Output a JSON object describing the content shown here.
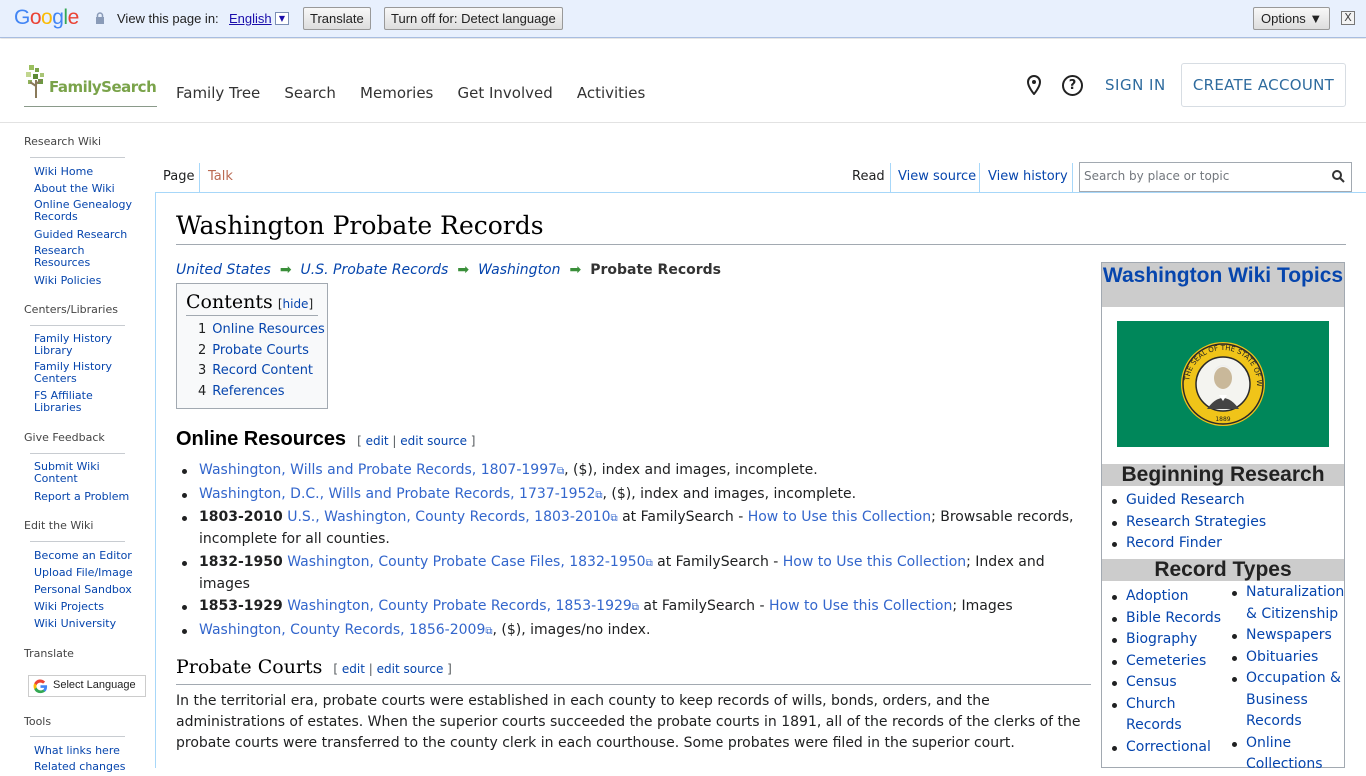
{
  "translate_bar": {
    "brand": "Google",
    "view_text": "View this page in:",
    "language": "English",
    "translate_btn": "Translate",
    "turn_off_btn": "Turn off for: Detect language",
    "options_btn": "Options ▼",
    "close": "X"
  },
  "header": {
    "logo_text": "FamilySearch",
    "nav": [
      "Family Tree",
      "Search",
      "Memories",
      "Get Involved",
      "Activities"
    ],
    "sign_in": "SIGN IN",
    "create_account": "CREATE ACCOUNT"
  },
  "sidebar": {
    "sections": [
      {
        "title": "Research Wiki",
        "items": [
          "Wiki Home",
          "About the Wiki",
          "Online Genealogy Records",
          "Guided Research",
          "Research Resources",
          "Wiki Policies"
        ]
      },
      {
        "title": "Centers/Libraries",
        "items": [
          "Family History Library",
          "Family History Centers",
          "FS Affiliate Libraries"
        ]
      },
      {
        "title": "Give Feedback",
        "items": [
          "Submit Wiki Content",
          "Report a Problem"
        ]
      },
      {
        "title": "Edit the Wiki",
        "items": [
          "Become an Editor",
          "Upload File/Image",
          "Personal Sandbox",
          "Wiki Projects",
          "Wiki University"
        ]
      },
      {
        "title": "Translate",
        "items": []
      },
      {
        "title": "Tools",
        "items": [
          "What links here",
          "Related changes"
        ]
      }
    ],
    "select_language": "Select Language"
  },
  "tabs": {
    "page": "Page",
    "talk": "Talk",
    "read": "Read",
    "view_source": "View source",
    "view_history": "View history",
    "search_placeholder": "Search by place or topic"
  },
  "article": {
    "title": "Washington Probate Records",
    "breadcrumb": [
      "United States",
      "U.S. Probate Records",
      "Washington"
    ],
    "breadcrumb_current": "Probate Records",
    "toc": {
      "title": "Contents",
      "hide": "hide",
      "items": [
        {
          "num": "1",
          "label": "Online Resources"
        },
        {
          "num": "2",
          "label": "Probate Courts"
        },
        {
          "num": "3",
          "label": "Record Content"
        },
        {
          "num": "4",
          "label": "References"
        }
      ]
    },
    "online_resources": {
      "heading": "Online Resources",
      "edit": "edit",
      "edit_source": "edit source",
      "items": [
        {
          "prefix": "",
          "link": "Washington, Wills and Probate Records, 1807-1997",
          "mid": ", ($), index and images, incomplete.",
          "how": "",
          "suffix": ""
        },
        {
          "prefix": "",
          "link": "Washington, D.C., Wills and Probate Records, 1737-1952",
          "mid": ", ($), index and images, incomplete.",
          "how": "",
          "suffix": ""
        },
        {
          "prefix": "1803-2010",
          "link": "U.S., Washington, County Records, 1803-2010",
          "mid": " at FamilySearch - ",
          "how": "How to Use this Collection",
          "suffix": "; Browsable records, incomplete for all counties."
        },
        {
          "prefix": "1832-1950",
          "link": "Washington, County Probate Case Files, 1832-1950",
          "mid": " at FamilySearch - ",
          "how": "How to Use this Collection",
          "suffix": "; Index and images"
        },
        {
          "prefix": "1853-1929",
          "link": "Washington, County Probate Records, 1853-1929",
          "mid": " at FamilySearch - ",
          "how": "How to Use this Collection",
          "suffix": "; Images"
        },
        {
          "prefix": "",
          "link": "Washington, County Records, 1856-2009",
          "mid": ", ($), images/no index.",
          "how": "",
          "suffix": ""
        }
      ]
    },
    "probate_courts": {
      "heading": "Probate Courts",
      "edit": "edit",
      "edit_source": "edit source",
      "paragraph": "In the territorial era, probate courts were established in each county to keep records of wills, bonds, orders, and the administrations of estates. When the superior courts succeeded the probate courts in 1891, all of the records of the clerks of the probate courts were transferred to the county clerk in each courthouse. Some probates were filed in the superior court."
    }
  },
  "infobox": {
    "title": "Washington Wiki Topics",
    "seal_text": "THE SEAL OF THE STATE OF WASHINGTON",
    "seal_year": "1889",
    "beginning_research": "Beginning Research",
    "beginning_items": [
      "Guided Research",
      "Research Strategies",
      "Record Finder"
    ],
    "record_types": "Record Types",
    "record_left": [
      "Adoption",
      "Bible Records",
      "Biography",
      "Cemeteries",
      "Census",
      "Church Records",
      "Correctional"
    ],
    "record_right": [
      "Naturalization & Citizenship",
      "Newspapers",
      "Obituaries",
      "Occupation & Business Records",
      "Online Collections"
    ]
  },
  "colors": {
    "link": "#0645ad",
    "flag_green": "#00875a",
    "brand_green": "#7aa34a"
  }
}
